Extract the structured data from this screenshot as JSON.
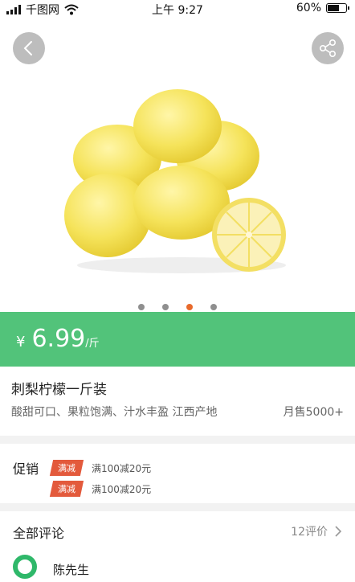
{
  "status_bar": {
    "carrier": "千图网",
    "time": "上午 9:27",
    "battery": "60%"
  },
  "gallery": {
    "total_slides": 4,
    "active_index": 2
  },
  "price": {
    "currency": "¥",
    "amount": "6.99",
    "unit": "/斤"
  },
  "product": {
    "title": "刺梨柠檬一斤装",
    "description": "酸甜可口、果粒饱满、汁水丰盈  江西产地",
    "monthly_sales": "月售5000+"
  },
  "promotion": {
    "label": "促销",
    "items": [
      {
        "tag": "满减",
        "text": "满100减20元"
      },
      {
        "tag": "满减",
        "text": "满100减20元"
      }
    ]
  },
  "reviews": {
    "title": "全部评论",
    "count": "12评价",
    "first_user": "陈先生"
  },
  "colors": {
    "accent_green": "#52c37a",
    "promo_red": "#e35a3c",
    "active_dot": "#e86a2c"
  }
}
